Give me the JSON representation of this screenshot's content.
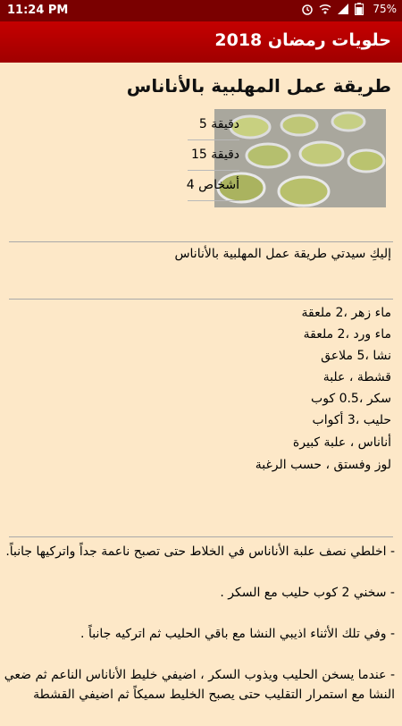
{
  "status_bar": {
    "time": "11:24 PM",
    "battery": "75%",
    "icons": [
      "alarm-icon",
      "wifi-icon",
      "signal-icon",
      "battery-icon"
    ]
  },
  "app_bar": {
    "title": "حلويات رمضان 2018"
  },
  "recipe": {
    "title": "طريقة عمل المهلبية بالأناناس",
    "prep_time": "5 دقيقة",
    "cook_time": "15 دقيقة",
    "servings": "4 أشخاص",
    "intro": "إليكِ سيدتي طريقة عمل المهلبية بالأناناس",
    "ingredients": [
      "ماء زهر ،2 ملعقة",
      "ماء ورد ،2 ملعقة",
      "نشا ،5 ملاعق",
      "قشطة ، علبة",
      "سكر ،0.5 كوب",
      "حليب ،3 أكواب",
      "أناناس ، علبة كبيرة",
      "لوز وفستق ، حسب الرغبة"
    ],
    "steps": [
      "- اخلطي نصف علبة الأناناس في الخلاط حتى تصبح ناعمة جداً واتركيها جانباً.",
      "- سخني 2 كوب حليب مع السكر .",
      "- وفي تلك الأثناء اذيبي النشا مع باقي الحليب ثم اتركيه جانباً .",
      "- عندما يسخن الحليب ويذوب السكر ، اضيفي خليط الأناناس الناعم ثم ضعي النشا مع استمرار التقليب حتى يصبح الخليط سميكاً ثم اضيفي القشطة"
    ]
  }
}
